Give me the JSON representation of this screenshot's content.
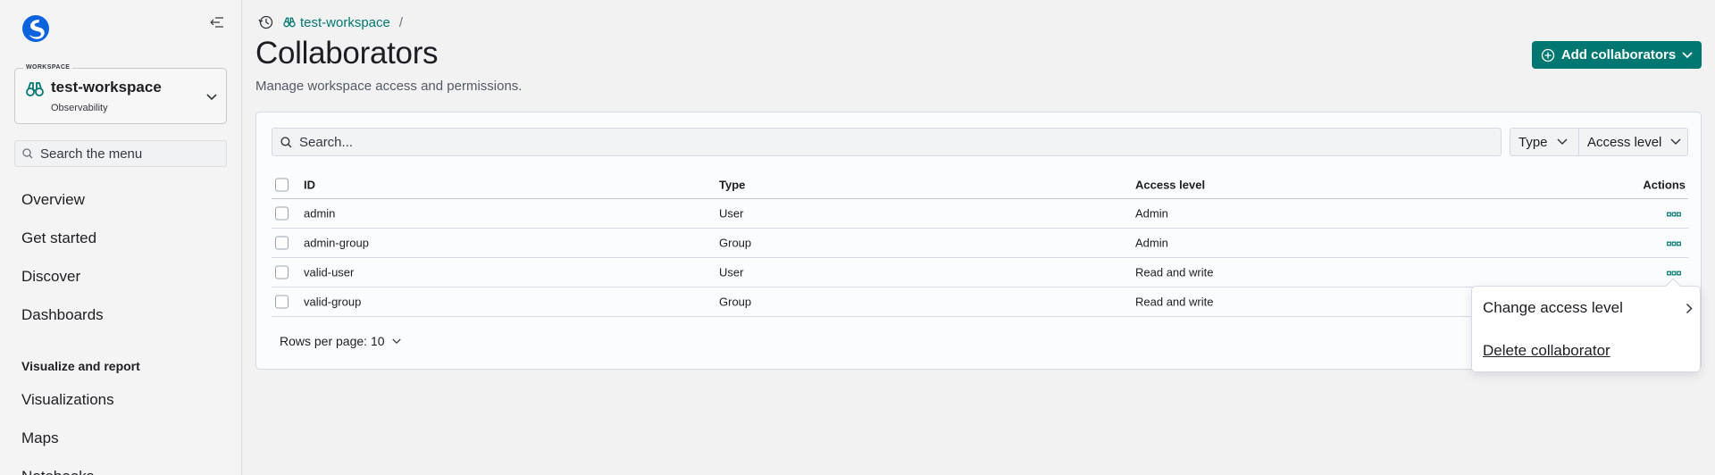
{
  "sidebar": {
    "workspace_legend": "WORKSPACE",
    "workspace_name": "test-workspace",
    "workspace_type": "Observability",
    "search_placeholder": "Search the menu",
    "items": [
      {
        "label": "Overview"
      },
      {
        "label": "Get started"
      },
      {
        "label": "Discover"
      },
      {
        "label": "Dashboards"
      }
    ],
    "section_title": "Visualize and report",
    "section_items": [
      {
        "label": "Visualizations"
      },
      {
        "label": "Maps"
      },
      {
        "label": "Notebooks"
      }
    ]
  },
  "breadcrumb": {
    "workspace": "test-workspace",
    "separator": "/"
  },
  "header": {
    "title": "Collaborators",
    "description": "Manage workspace access and permissions.",
    "add_button_label": "Add collaborators"
  },
  "toolbar": {
    "search_placeholder": "Search...",
    "filter_type": "Type",
    "filter_access": "Access level"
  },
  "table": {
    "columns": [
      "ID",
      "Type",
      "Access level",
      "Actions"
    ],
    "rows": [
      {
        "id": "admin",
        "type": "User",
        "access": "Admin"
      },
      {
        "id": "admin-group",
        "type": "Group",
        "access": "Admin"
      },
      {
        "id": "valid-user",
        "type": "User",
        "access": "Read and write"
      },
      {
        "id": "valid-group",
        "type": "Group",
        "access": "Read and write"
      }
    ],
    "rows_per_page": "Rows per page: 10"
  },
  "popover": {
    "change_access": "Change access level",
    "delete": "Delete collaborator"
  },
  "colors": {
    "accent": "#007871",
    "logo_blue": "#0b64dd"
  }
}
